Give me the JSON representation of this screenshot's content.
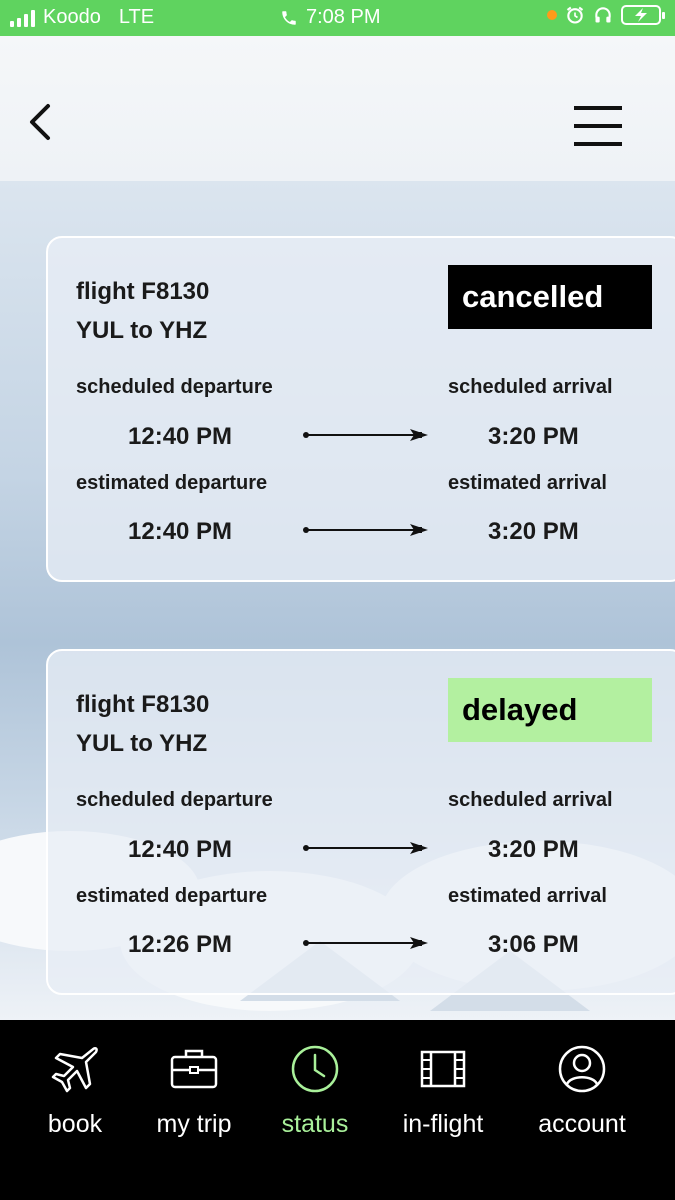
{
  "status_bar": {
    "carrier": "Koodo",
    "network": "LTE",
    "time": "7:08 PM",
    "colors": {
      "background": "#5fd35f",
      "dot": "#ff9a1a"
    },
    "icons": [
      "signal-bars-icon",
      "phone-icon",
      "alarm-icon",
      "headphones-icon",
      "battery-charging-icon"
    ]
  },
  "header": {
    "icons": {
      "back": "chevron-left-icon",
      "menu": "hamburger-menu-icon"
    }
  },
  "flights": [
    {
      "flight_number": "flight F8130",
      "route": "YUL to YHZ",
      "status": "cancelled",
      "status_color": "#000000",
      "scheduled_departure_label": "scheduled departure",
      "scheduled_departure": "12:40 PM",
      "scheduled_arrival_label": "scheduled arrival",
      "scheduled_arrival": "3:20 PM",
      "estimated_departure_label": "estimated departure",
      "estimated_departure": "12:40 PM",
      "estimated_arrival_label": "estimated arrival",
      "estimated_arrival": "3:20 PM"
    },
    {
      "flight_number": "flight F8130",
      "route": "YUL to YHZ",
      "status": "delayed",
      "status_color": "#b3f0a0",
      "scheduled_departure_label": "scheduled departure",
      "scheduled_departure": "12:40 PM",
      "scheduled_arrival_label": "scheduled arrival",
      "scheduled_arrival": "3:20 PM",
      "estimated_departure_label": "estimated departure",
      "estimated_departure": "12:26 PM",
      "estimated_arrival_label": "estimated arrival",
      "estimated_arrival": "3:06 PM"
    }
  ],
  "bottom_nav": {
    "items": [
      {
        "label": "book",
        "icon": "airplane-icon",
        "active": false
      },
      {
        "label": "my trip",
        "icon": "briefcase-icon",
        "active": false
      },
      {
        "label": "status",
        "icon": "clock-icon",
        "active": true
      },
      {
        "label": "in-flight",
        "icon": "film-icon",
        "active": false
      },
      {
        "label": "account",
        "icon": "user-circle-icon",
        "active": false
      }
    ],
    "colors": {
      "background": "#000000",
      "active": "#a9f09a",
      "inactive": "#ffffff"
    }
  }
}
